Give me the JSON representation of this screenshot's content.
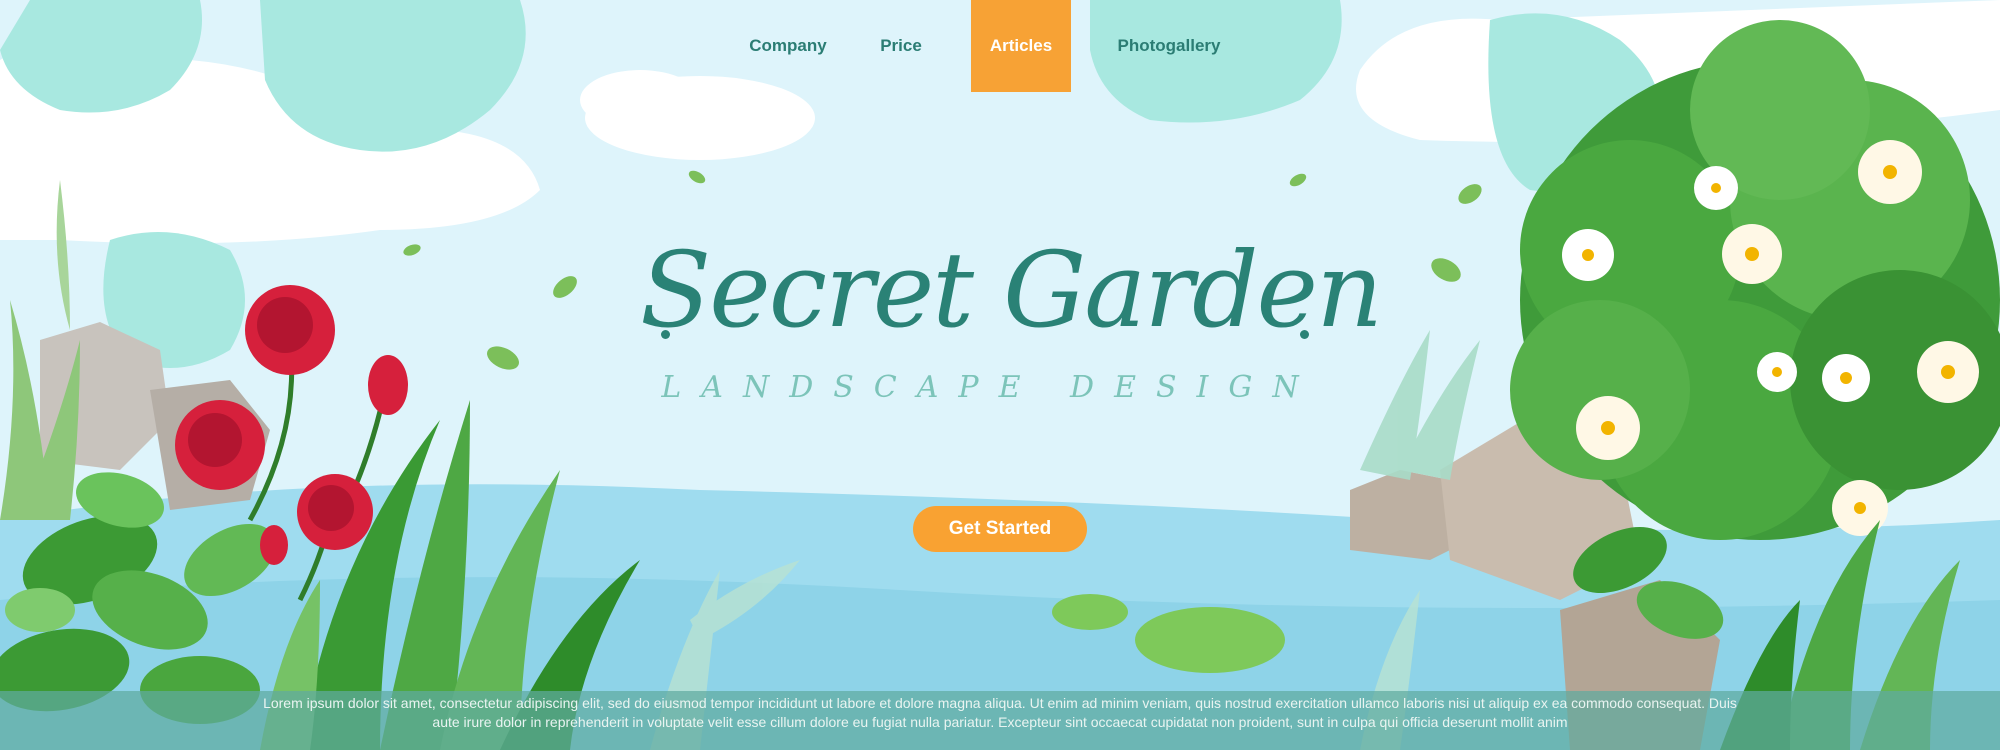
{
  "nav": {
    "items": [
      {
        "label": "Company",
        "active": false
      },
      {
        "label": "Price",
        "active": false
      },
      {
        "label": "Articles",
        "active": true
      },
      {
        "label": "Photogallery",
        "active": false
      }
    ],
    "active_color": "#f7a235"
  },
  "hero": {
    "title": "Secret Garden",
    "subtitle": "LANDSCAPE DESIGN",
    "cta_label": "Get Started"
  },
  "footer": {
    "text": "Lorem ipsum dolor sit amet, consectetur adipiscing elit, sed do eiusmod tempor incididunt ut labore et dolore magna aliqua. Ut enim ad minim veniam, quis nostrud exercitation ullamco laboris nisi ut aliquip ex ea commodo consequat. Duis aute irure dolor in reprehenderit in voluptate velit esse cillum dolore eu fugiat nulla pariatur. Excepteur sint occaecat cupidatat non proident, sunt in culpa qui officia deserunt mollit anim"
  },
  "colors": {
    "sky": "#def4fb",
    "water": "#9fdcef",
    "brand_teal": "#2a8276",
    "accent_orange": "#f9a232",
    "leaf_green": "#3f9b3a",
    "rose_red": "#d6203c"
  }
}
